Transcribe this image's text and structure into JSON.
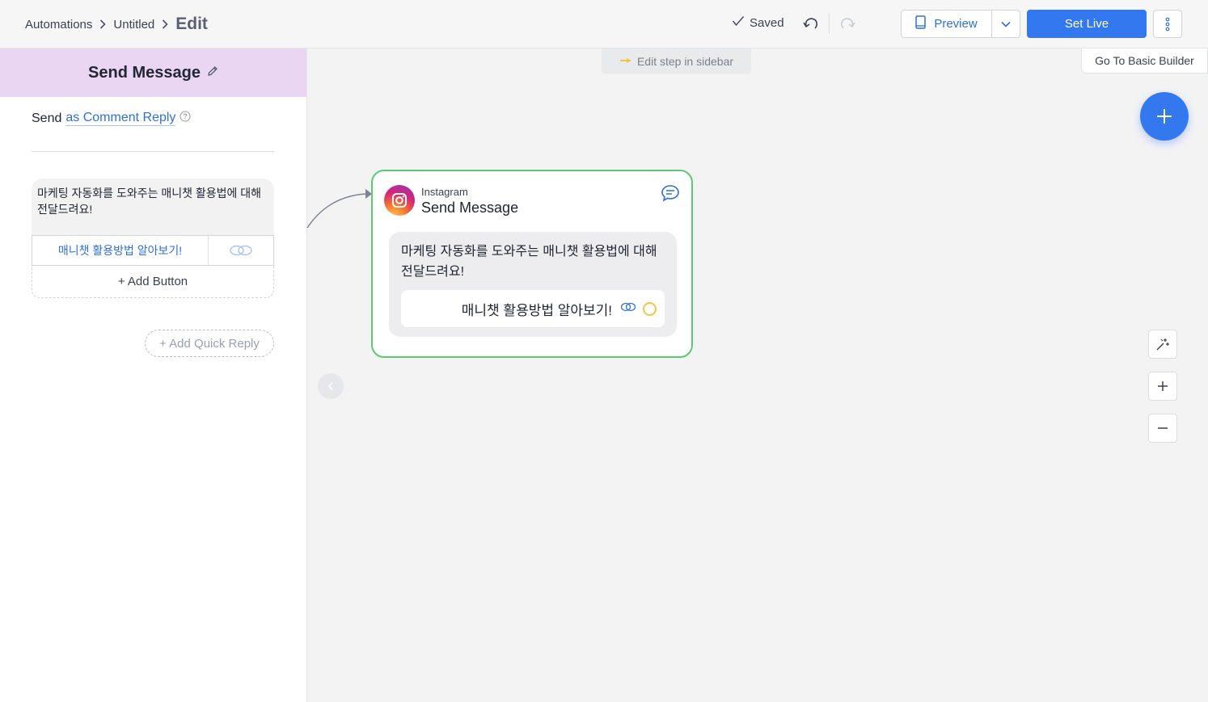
{
  "breadcrumb": {
    "items": [
      "Automations",
      "Untitled"
    ],
    "current": "Edit"
  },
  "header": {
    "saved_label": "Saved",
    "preview_label": "Preview",
    "set_live_label": "Set Live"
  },
  "sidebar": {
    "title": "Send Message",
    "send_prefix": "Send",
    "send_mode": "as Comment Reply",
    "message_text": "마케팅 자동화를 도와주는 매니챗 활용법에 대해 전달드려요!",
    "button_label": "매니챗 활용방법 알아보기!",
    "add_button_label": "+ Add Button",
    "add_quick_reply_label": "+ Add Quick Reply"
  },
  "canvas": {
    "hint": "Edit step in sidebar",
    "basic_builder_label": "Go To Basic Builder",
    "node": {
      "platform": "Instagram",
      "title": "Send Message",
      "message_text": "마케팅 자동화를 도와주는 매니챗 활용법에 대해 전달드려요!",
      "button_label": "매니챗 활용방법 알아보기!"
    }
  },
  "colors": {
    "accent": "#3478f0",
    "link": "#2f6fdc",
    "sidebar_header": "#ead5f2",
    "node_border": "#5cc970"
  }
}
